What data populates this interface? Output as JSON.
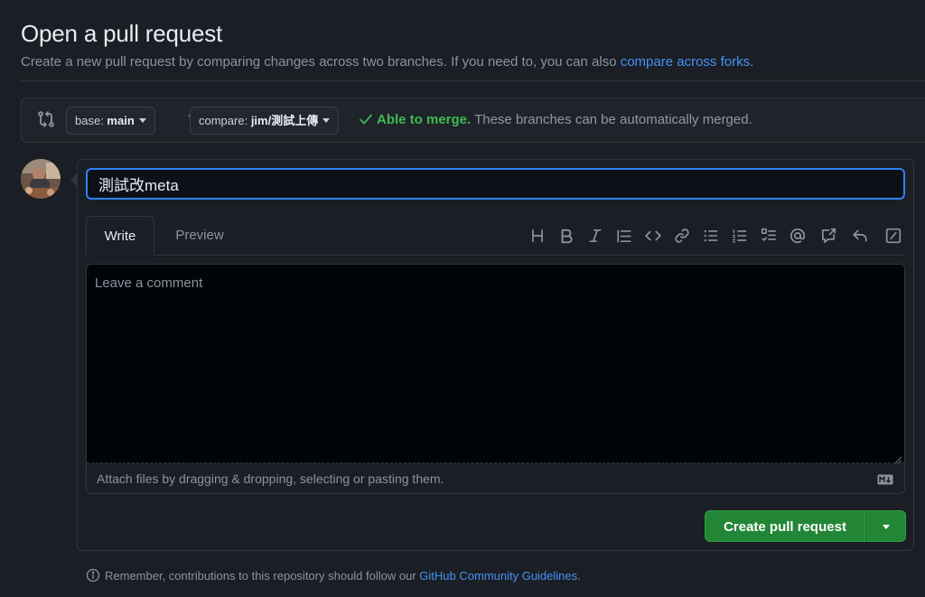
{
  "header": {
    "title": "Open a pull request",
    "subtitle_text": "Create a new pull request by comparing changes across two branches. If you need to, you can also ",
    "subtitle_link": "compare across forks",
    "subtitle_end": "."
  },
  "compare_bar": {
    "base_prefix": "base: ",
    "base_branch": "main",
    "compare_prefix": "compare: ",
    "compare_branch": "jim/測試上傳",
    "merge_status": "Able to merge.",
    "merge_description": " These branches can be automatically merged."
  },
  "form": {
    "title_value": "測試改meta",
    "tabs": [
      "Write",
      "Preview"
    ],
    "toolbar_icons": [
      "heading-icon",
      "bold-icon",
      "italic-icon",
      "quote-icon",
      "code-icon",
      "link-icon",
      "unordered-list-icon",
      "ordered-list-icon",
      "task-list-icon",
      "mention-icon",
      "reference-icon",
      "reply-icon",
      "slash-command-icon"
    ],
    "comment_placeholder": "Leave a comment",
    "attach_text": "Attach files by dragging & dropping, selecting or pasting them.",
    "submit_label": "Create pull request"
  },
  "footer": {
    "reminder_text": "Remember, contributions to this repository should follow our ",
    "reminder_link": "GitHub Community Guidelines",
    "reminder_end": "."
  },
  "colors": {
    "background": "#1b1e24",
    "accent_blue": "#4493f8",
    "success_green": "#3fb950",
    "button_green": "#238636"
  }
}
